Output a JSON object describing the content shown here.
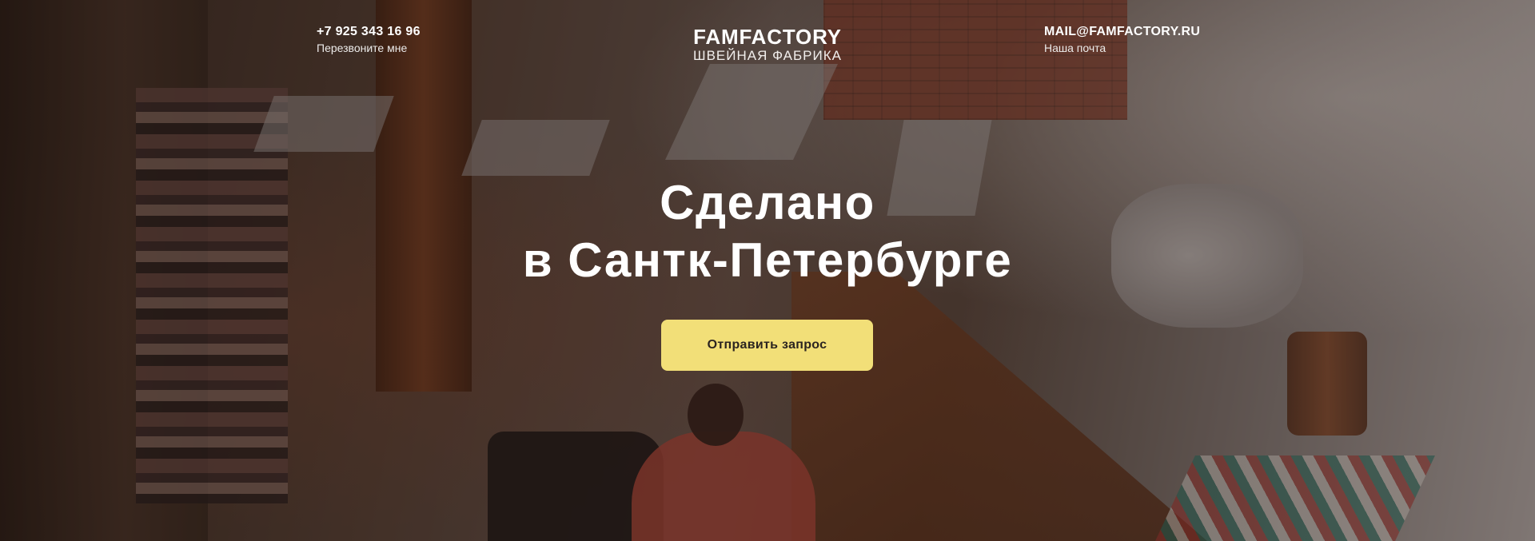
{
  "header": {
    "phone": {
      "number": "+7 925 343 16 96",
      "caption": "Перезвоните мне"
    },
    "logo": {
      "name": "FAMFACTORY",
      "subtitle": "ШВЕЙНАЯ ФАБРИКА"
    },
    "mail": {
      "address": "MAIL@FAMFACTORY.RU",
      "caption": "Наша почта"
    }
  },
  "hero": {
    "title_line1": "Сделано",
    "title_line2": "в Сантк-Петербурге",
    "cta_label": "Отправить запрос"
  },
  "colors": {
    "accent": "#f2df78",
    "text": "#ffffff",
    "button_text": "#2b2420"
  }
}
